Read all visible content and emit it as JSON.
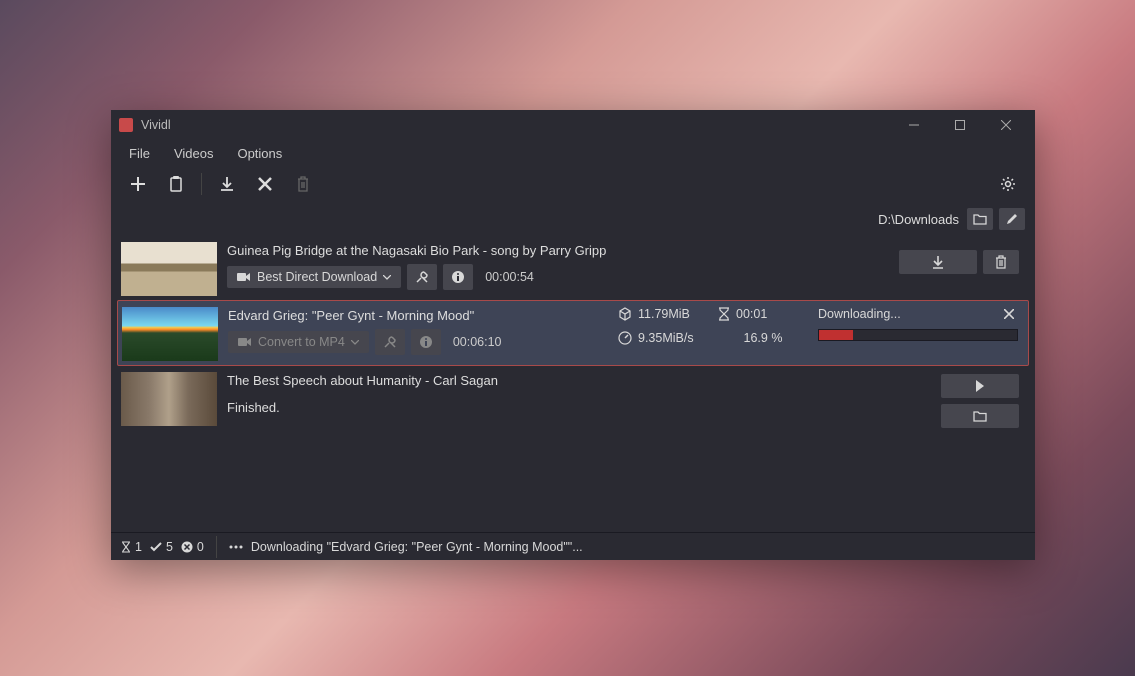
{
  "app": {
    "title": "Vividl"
  },
  "menu": {
    "file": "File",
    "videos": "Videos",
    "options": "Options"
  },
  "downloadPath": "D:\\Downloads",
  "items": [
    {
      "title": "Guinea Pig Bridge at the Nagasaki Bio Park - song by Parry Gripp",
      "formatLabel": "Best Direct Download",
      "duration": "00:00:54"
    },
    {
      "title": "Edvard Grieg: \"Peer Gynt - Morning Mood\"",
      "formatLabel": "Convert to MP4",
      "duration": "00:06:10",
      "size": "11.79MiB",
      "eta": "00:01",
      "speed": "9.35MiB/s",
      "percent": "16.9 %",
      "status": "Downloading...",
      "progressPct": 17
    },
    {
      "title": "The Best Speech about Humanity - Carl Sagan",
      "status": "Finished."
    }
  ],
  "statusbar": {
    "pending": "1",
    "done": "5",
    "failed": "0",
    "message": "Downloading \"Edvard Grieg: \"Peer Gynt - Morning Mood\"\"..."
  }
}
